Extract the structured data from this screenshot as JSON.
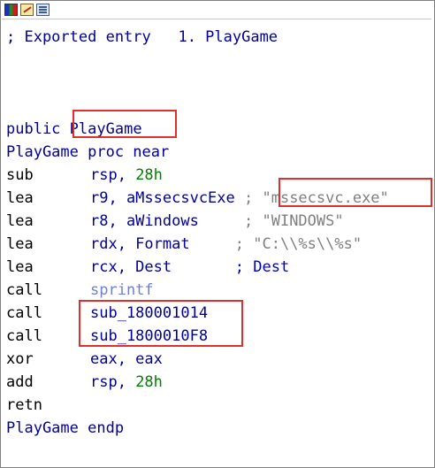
{
  "toolbar": {
    "icons": [
      "graph-view-icon",
      "edit-icon",
      "hex-view-icon"
    ]
  },
  "disasm": {
    "header_comment": "; Exported entry   1. PlayGame",
    "public_kw": "public",
    "public_name": "PlayGame",
    "proc_line": "PlayGame proc near",
    "instructions": [
      {
        "mnem": "sub",
        "op1": "rsp, ",
        "imm": "28h",
        "comment": ""
      },
      {
        "mnem": "lea",
        "op1": "r9, aMssecsvcExe",
        "sep": " ; ",
        "str": "\"mssecsvc.exe\""
      },
      {
        "mnem": "lea",
        "op1": "r8, aWindows",
        "sep": "     ; ",
        "str": "\"WINDOWS\""
      },
      {
        "mnem": "lea",
        "op1": "rdx, Format",
        "sep": "     ; ",
        "str": "\"C:\\\\%s\\\\%s\""
      },
      {
        "mnem": "lea",
        "op1": "rcx, Dest",
        "sep": "       ; ",
        "cmt": "Dest"
      },
      {
        "mnem": "call",
        "func": "sprintf"
      },
      {
        "mnem": "call",
        "func2": "sub_180001014"
      },
      {
        "mnem": "call",
        "func2": "sub_1800010F8"
      },
      {
        "mnem": "xor",
        "op1": "eax, eax"
      },
      {
        "mnem": "add",
        "op1": "rsp, ",
        "imm": "28h"
      },
      {
        "mnem": "retn"
      }
    ],
    "endp_line": "PlayGame endp"
  },
  "colors": {
    "highlight_box": "#e0302c",
    "keyword": "#0000a0",
    "string_comment": "#808080",
    "imported_func": "#6f7fd8",
    "immediate": "#007f00"
  }
}
